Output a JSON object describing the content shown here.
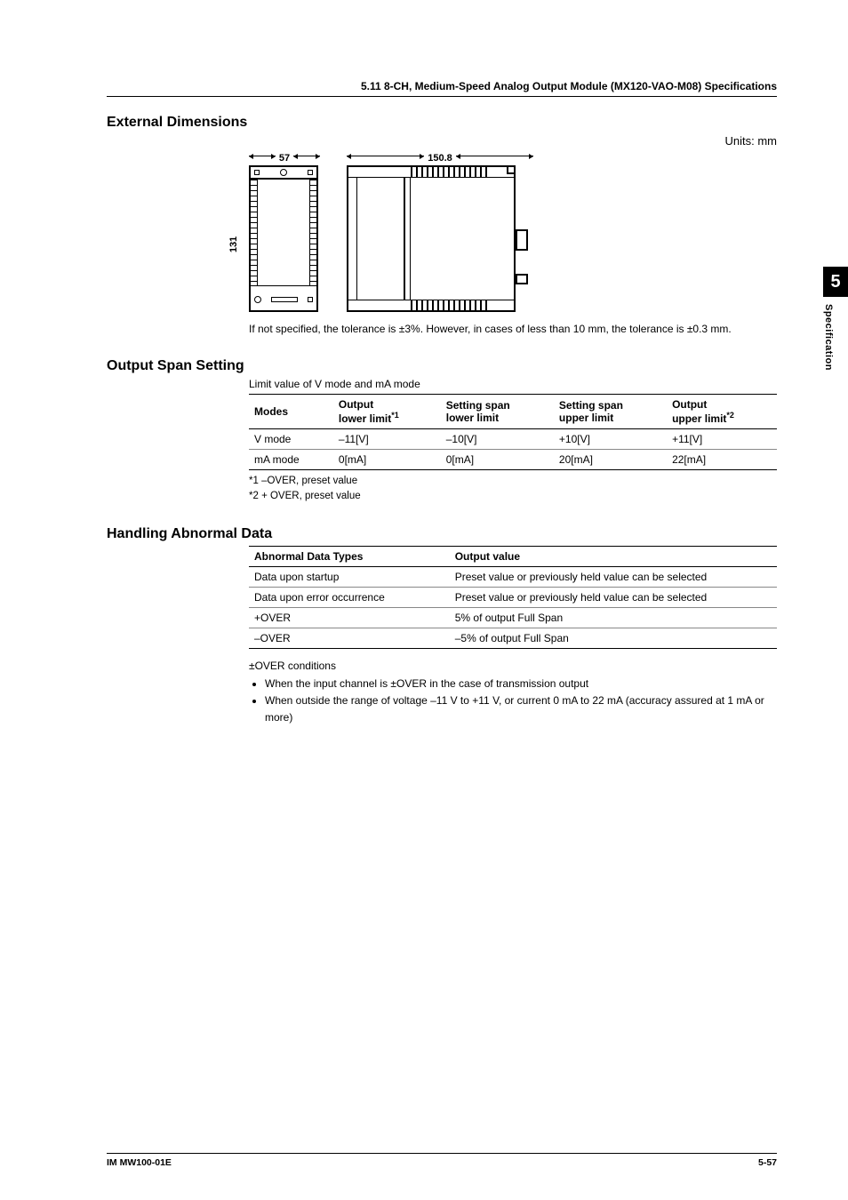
{
  "header": {
    "title": "5.11  8-CH, Medium-Speed Analog Output Module (MX120-VAO-M08) Specifications"
  },
  "sidebar": {
    "chapter": "5",
    "label": "Specification"
  },
  "dimensions": {
    "heading": "External Dimensions",
    "units": "Units: mm",
    "width_front": "57",
    "width_side": "150.8",
    "height": "131",
    "note": "If not specified, the tolerance is ±3%. However, in cases of less than 10 mm, the tolerance is ±0.3 mm."
  },
  "span": {
    "heading": "Output Span Setting",
    "intro": "Limit value of V mode and mA mode",
    "headers": {
      "modes": "Modes",
      "out_low": "Output",
      "out_low2": "lower limit",
      "out_low_sup": "*1",
      "set_low": "Setting span",
      "set_low2": "lower limit",
      "set_up": "Setting span",
      "set_up2": "upper limit",
      "out_up": "Output",
      "out_up2": "upper limit",
      "out_up_sup": "*2"
    },
    "rows": [
      {
        "mode": "V mode",
        "ol": "–11[V]",
        "sl": "–10[V]",
        "su": "+10[V]",
        "ou": "+11[V]"
      },
      {
        "mode": "mA mode",
        "ol": "0[mA]",
        "sl": "0[mA]",
        "su": "20[mA]",
        "ou": "22[mA]"
      }
    ],
    "footnote1": "*1  –OVER, preset value",
    "footnote2": "*2  + OVER, preset value"
  },
  "abnormal": {
    "heading": "Handling Abnormal Data",
    "headers": {
      "type": "Abnormal Data Types",
      "value": "Output value"
    },
    "rows": [
      {
        "t": "Data upon startup",
        "v": "Preset value or previously held value can be selected"
      },
      {
        "t": "Data upon error occurrence",
        "v": "Preset value or previously held value can be selected"
      },
      {
        "t": "+OVER",
        "v": "5% of output Full Span"
      },
      {
        "t": "–OVER",
        "v": "–5% of output Full Span"
      }
    ],
    "cond_head": "±OVER conditions",
    "bullets": [
      "When the input channel is ±OVER in the case of transmission output",
      "When outside the range of voltage –11 V to +11 V, or current 0 mA to 22 mA (accuracy assured at 1 mA or more)"
    ]
  },
  "footer": {
    "left": "IM MW100-01E",
    "right": "5-57"
  }
}
